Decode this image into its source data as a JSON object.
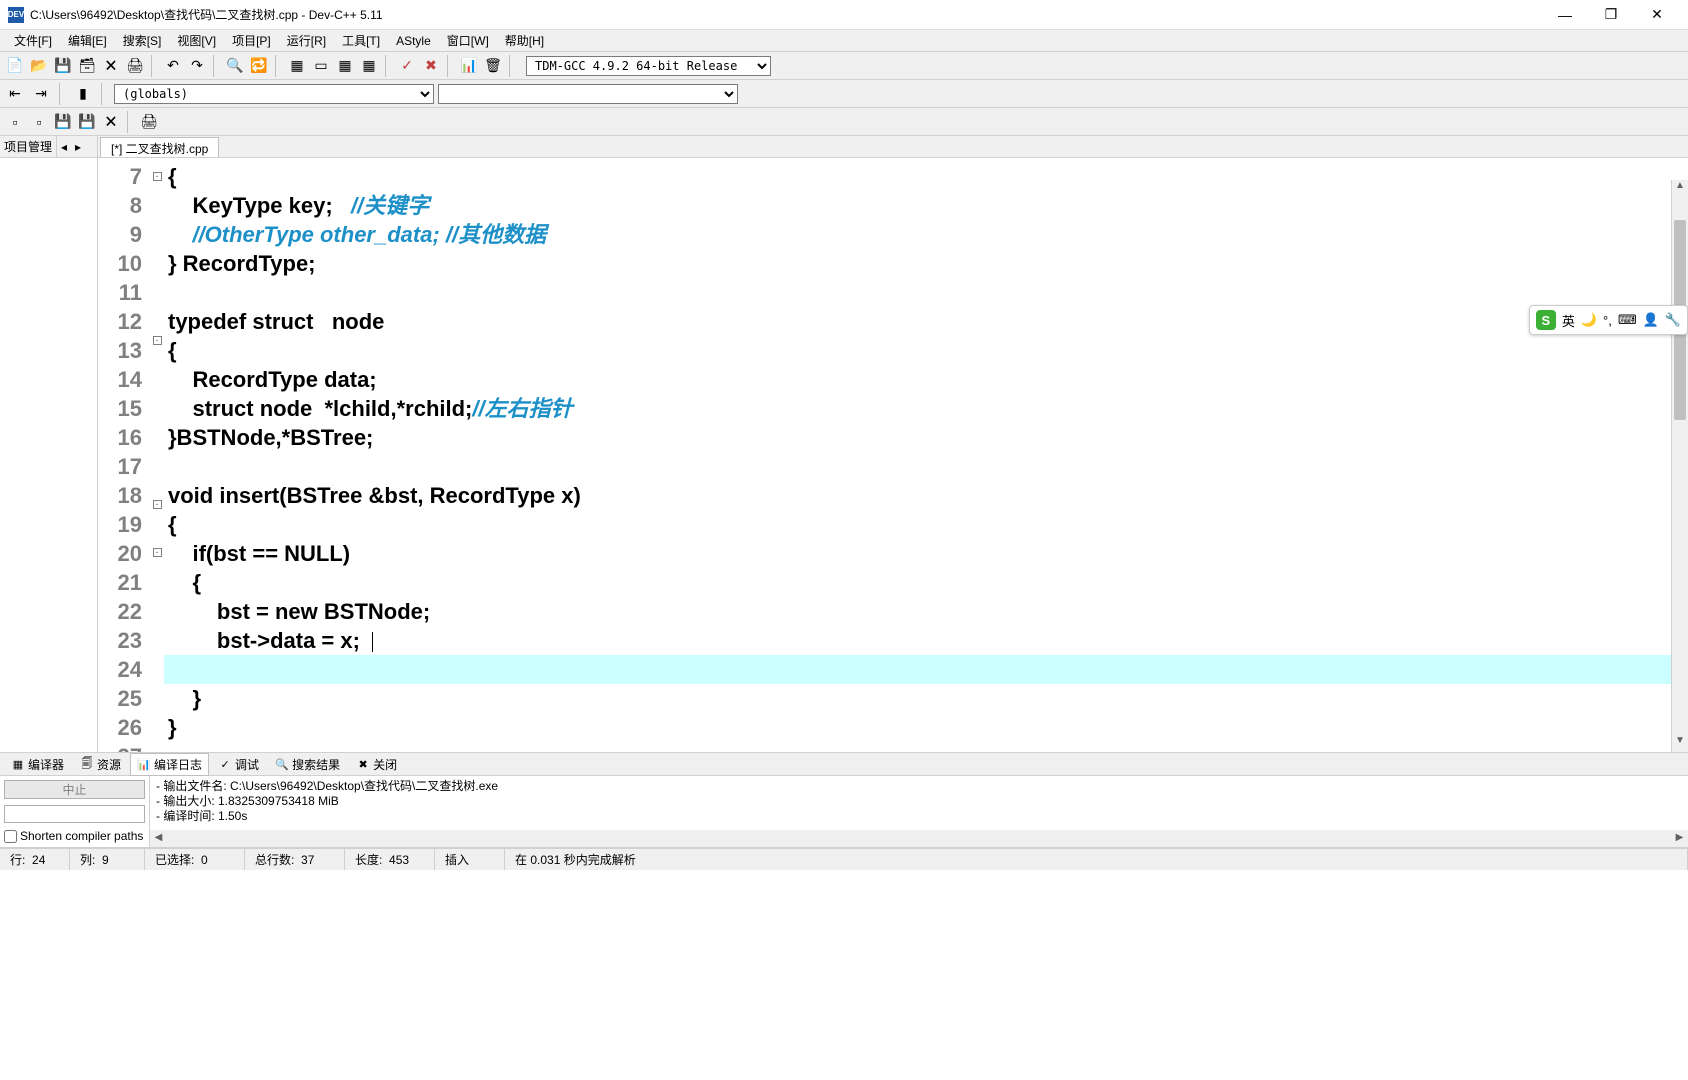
{
  "window": {
    "title": "C:\\Users\\96492\\Desktop\\查找代码\\二叉查找树.cpp - Dev-C++ 5.11"
  },
  "menu": {
    "items": [
      "文件[F]",
      "编辑[E]",
      "搜索[S]",
      "视图[V]",
      "项目[P]",
      "运行[R]",
      "工具[T]",
      "AStyle",
      "窗口[W]",
      "帮助[H]"
    ]
  },
  "toolbar": {
    "compiler_select": "TDM-GCC 4.9.2 64-bit Release",
    "globals": "(globals)"
  },
  "sidebar": {
    "tab": "项目管理"
  },
  "file_tab": "[*] 二叉查找树.cpp",
  "gutter_start": 7,
  "code_lines": [
    {
      "fold": "box",
      "seg": [
        {
          "c": "pl",
          "t": "{"
        }
      ]
    },
    {
      "seg": [
        {
          "c": "pl",
          "t": "    KeyType key;   "
        },
        {
          "c": "cm",
          "t": "//关键字"
        }
      ]
    },
    {
      "seg": [
        {
          "c": "pl",
          "t": "    "
        },
        {
          "c": "cm",
          "t": "//OtherType other_data; //其他数据"
        }
      ]
    },
    {
      "seg": [
        {
          "c": "pl",
          "t": "} RecordType;"
        }
      ]
    },
    {
      "seg": [
        {
          "c": "pl",
          "t": " "
        }
      ]
    },
    {
      "seg": [
        {
          "c": "kw",
          "t": "typedef struct"
        },
        {
          "c": "pl",
          "t": "   node"
        }
      ]
    },
    {
      "fold": "box",
      "seg": [
        {
          "c": "pl",
          "t": "{"
        }
      ]
    },
    {
      "seg": [
        {
          "c": "pl",
          "t": "    RecordType data;"
        }
      ]
    },
    {
      "seg": [
        {
          "c": "pl",
          "t": "    "
        },
        {
          "c": "kw",
          "t": "struct"
        },
        {
          "c": "pl",
          "t": " node  *lchild,*rchild;"
        },
        {
          "c": "cm",
          "t": "//左右指针"
        }
      ]
    },
    {
      "seg": [
        {
          "c": "pl",
          "t": "}BSTNode,*BSTree;"
        }
      ]
    },
    {
      "seg": [
        {
          "c": "pl",
          "t": " "
        }
      ]
    },
    {
      "seg": [
        {
          "c": "kw",
          "t": "void"
        },
        {
          "c": "pl",
          "t": " insert(BSTree &bst, RecordType x)"
        }
      ]
    },
    {
      "fold": "box",
      "seg": [
        {
          "c": "pl",
          "t": "{"
        }
      ]
    },
    {
      "seg": [
        {
          "c": "pl",
          "t": "    "
        },
        {
          "c": "kw",
          "t": "if"
        },
        {
          "c": "pl",
          "t": "(bst == NULL)"
        }
      ]
    },
    {
      "fold": "box",
      "seg": [
        {
          "c": "pl",
          "t": "    {"
        }
      ]
    },
    {
      "seg": [
        {
          "c": "pl",
          "t": "        bst = "
        },
        {
          "c": "kw",
          "t": "new"
        },
        {
          "c": "pl",
          "t": " BSTNode;"
        }
      ]
    },
    {
      "seg": [
        {
          "c": "pl",
          "t": "        bst->data = x; "
        }
      ],
      "cursor": true
    },
    {
      "hl": true,
      "seg": [
        {
          "c": "pl",
          "t": "         "
        }
      ]
    },
    {
      "seg": [
        {
          "c": "pl",
          "t": "    }"
        }
      ]
    },
    {
      "seg": [
        {
          "c": "pl",
          "t": "}"
        }
      ]
    },
    {
      "seg": [
        {
          "c": "pl",
          "t": " "
        }
      ]
    }
  ],
  "bottom_tabs": [
    {
      "icon": "▦",
      "label": "编译器"
    },
    {
      "icon": "🗐",
      "label": "资源"
    },
    {
      "icon": "📊",
      "label": "编译日志",
      "active": true
    },
    {
      "icon": "✓",
      "label": "调试"
    },
    {
      "icon": "🔍",
      "label": "搜索结果"
    },
    {
      "icon": "✖",
      "label": "关闭"
    }
  ],
  "output": {
    "abort_btn": "中止",
    "shorten": "Shorten compiler paths",
    "lines": [
      "- 输出文件名: C:\\Users\\96492\\Desktop\\查找代码\\二叉查找树.exe",
      "- 输出大小: 1.8325309753418 MiB",
      "- 编译时间: 1.50s"
    ]
  },
  "status": {
    "line_lbl": "行:",
    "line": "24",
    "col_lbl": "列:",
    "col": "9",
    "sel_lbl": "已选择:",
    "sel": "0",
    "total_lbl": "总行数:",
    "total": "37",
    "len_lbl": "长度:",
    "len": "453",
    "mode": "插入",
    "parse": "在 0.031 秒内完成解析"
  },
  "ime": {
    "lang": "英"
  }
}
